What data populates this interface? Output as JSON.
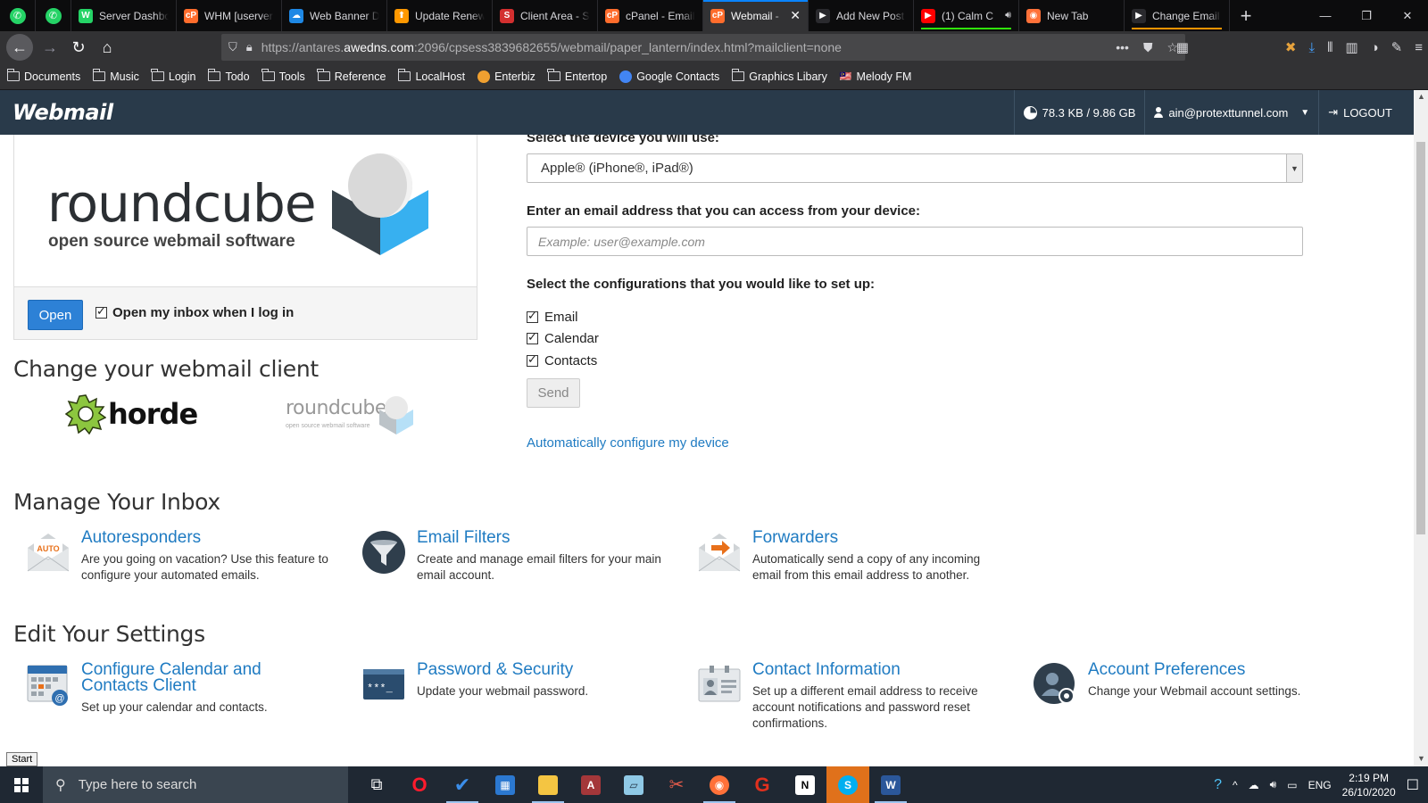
{
  "browser": {
    "tabs": [
      {
        "title": "Server Dashboard",
        "fav_color": "#25d366",
        "fav_glyph": "W"
      },
      {
        "title": "WHM [userver",
        "fav_color": "#ff6c2c",
        "fav_glyph": "cP"
      },
      {
        "title": "Web Banner D",
        "fav_color": "#1e88e5",
        "fav_glyph": "☁"
      },
      {
        "title": "Update Renew",
        "fav_color": "#ff9800",
        "fav_glyph": "⬆"
      },
      {
        "title": "Client Area - S",
        "fav_color": "#d32f2f",
        "fav_glyph": "S"
      },
      {
        "title": "cPanel - Email",
        "fav_color": "#ff6c2c",
        "fav_glyph": "cP"
      },
      {
        "title": "Webmail -",
        "fav_color": "#ff6c2c",
        "fav_glyph": "cP"
      },
      {
        "title": "Add New Post",
        "fav_color": "#2a2a2e",
        "fav_glyph": "▶"
      },
      {
        "title": "(1) Calm C",
        "fav_color": "#ff0000",
        "fav_glyph": "▶"
      },
      {
        "title": "New Tab",
        "fav_color": "#ff7139",
        "fav_glyph": "◉"
      },
      {
        "title": "Change Email",
        "fav_color": "#2a2a2e",
        "fav_glyph": "▶"
      }
    ],
    "url_prefix": "https://antares.",
    "url_host": "awedns.com",
    "url_rest": ":2096/cpsess3839682655/webmail/paper_lantern/index.html?mailclient=none",
    "bookmarks": [
      {
        "label": "Documents",
        "type": "folder"
      },
      {
        "label": "Music",
        "type": "folder"
      },
      {
        "label": "Login",
        "type": "folder"
      },
      {
        "label": "Todo",
        "type": "folder"
      },
      {
        "label": "Tools",
        "type": "folder"
      },
      {
        "label": "Reference",
        "type": "folder"
      },
      {
        "label": "LocalHost",
        "type": "folder"
      },
      {
        "label": "Enterbiz",
        "type": "dot",
        "color": "#f0a030"
      },
      {
        "label": "Entertop",
        "type": "folder"
      },
      {
        "label": "Google Contacts",
        "type": "dot",
        "color": "#4285f4"
      },
      {
        "label": "Graphics Libary",
        "type": "folder"
      },
      {
        "label": "Melody FM",
        "type": "flag"
      }
    ]
  },
  "webmail": {
    "logo": "Webmail",
    "disk_usage": "78.3 KB / 9.86 GB",
    "user": "ain@protexttunnel.com",
    "logout": "LOGOUT"
  },
  "client_panel": {
    "rc_word": "roundcube",
    "rc_sub": "open source webmail software",
    "open_button": "Open",
    "open_inbox_label": "Open my inbox when I log in",
    "open_inbox_checked": true
  },
  "change_client": {
    "heading": "Change your webmail client",
    "horde": "horde",
    "roundcube": "roundcube",
    "roundcube_sub": "open source webmail software"
  },
  "device_form": {
    "device_label": "Select the device you will use:",
    "device_value": "Apple® (iPhone®, iPad®)",
    "email_label": "Enter an email address that you can access from your device:",
    "email_placeholder": "Example: user@example.com",
    "config_label": "Select the configurations that you would like to set up:",
    "configs": [
      {
        "label": "Email",
        "checked": true
      },
      {
        "label": "Calendar",
        "checked": true
      },
      {
        "label": "Contacts",
        "checked": true
      }
    ],
    "send_button": "Send",
    "auto_link": "Automatically configure my device"
  },
  "manage_inbox": {
    "heading": "Manage Your Inbox",
    "items": [
      {
        "title": "Autoresponders",
        "desc": "Are you going on vacation? Use this feature to configure your automated emails.",
        "icon": "autoresponder-icon"
      },
      {
        "title": "Email Filters",
        "desc": "Create and manage email filters for your main email account.",
        "icon": "filter-icon"
      },
      {
        "title": "Forwarders",
        "desc": "Automatically send a copy of any incoming email from this email address to another.",
        "icon": "forwarder-icon"
      }
    ]
  },
  "edit_settings": {
    "heading": "Edit Your Settings",
    "items": [
      {
        "title": "Configure Calendar and Contacts Client",
        "desc": "Set up your calendar and contacts.",
        "icon": "calendar-icon"
      },
      {
        "title": "Password & Security",
        "desc": "Update your webmail password.",
        "icon": "password-icon"
      },
      {
        "title": "Contact Information",
        "desc": "Set up a different email address to receive account notifications and password reset confirmations.",
        "icon": "contact-card-icon"
      },
      {
        "title": "Account Preferences",
        "desc": "Change your Webmail account settings.",
        "icon": "account-gear-icon"
      }
    ]
  },
  "taskbar": {
    "start_tooltip": "Start",
    "search_placeholder": "Type here to search",
    "language": "ENG",
    "time": "2:19 PM",
    "date": "26/10/2020"
  }
}
